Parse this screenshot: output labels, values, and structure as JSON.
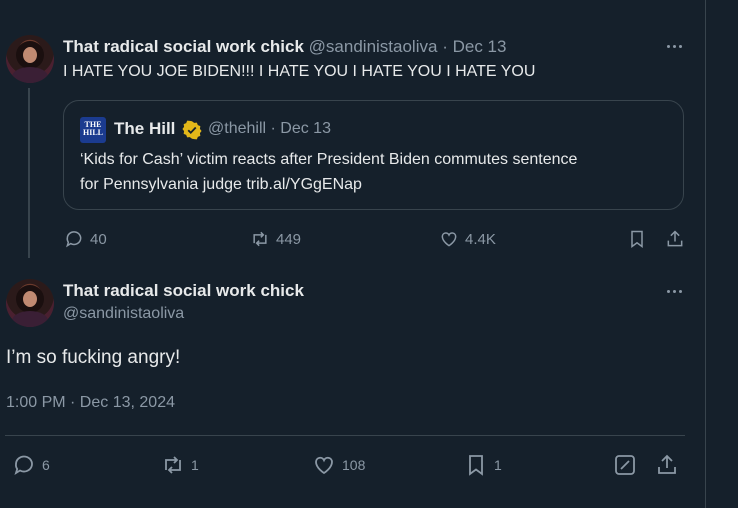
{
  "tweet1": {
    "display_name": "That radical social work chick",
    "handle": "@sandinistaoliva",
    "date_sep": "·",
    "date": "Dec 13",
    "text": "I HATE YOU JOE BIDEN!!! I HATE YOU I HATE YOU I HATE YOU",
    "quote": {
      "logo_text": "THE HILL",
      "name": "The Hill",
      "handle": "@thehill",
      "date_sep": "·",
      "date": "Dec 13",
      "text_line1": "‘Kids for Cash’ victim reacts after President Biden commutes sentence",
      "text_line2": "for Pennsylvania judge trib.al/YGgENap"
    },
    "actions": {
      "replies": "40",
      "reposts": "449",
      "likes": "4.4K"
    }
  },
  "tweet2": {
    "display_name": "That radical social work chick",
    "handle": "@sandinistaoliva",
    "text": "I’m so fucking angry!",
    "timestamp": "1:00 PM · Dec 13, 2024",
    "actions": {
      "replies": "6",
      "reposts": "1",
      "likes": "108",
      "bookmarks": "1"
    }
  },
  "colors": {
    "background": "#15202b",
    "text": "#e7e9ea",
    "muted": "#8b98a5",
    "border": "#38444d",
    "verified": "#e2b719"
  }
}
